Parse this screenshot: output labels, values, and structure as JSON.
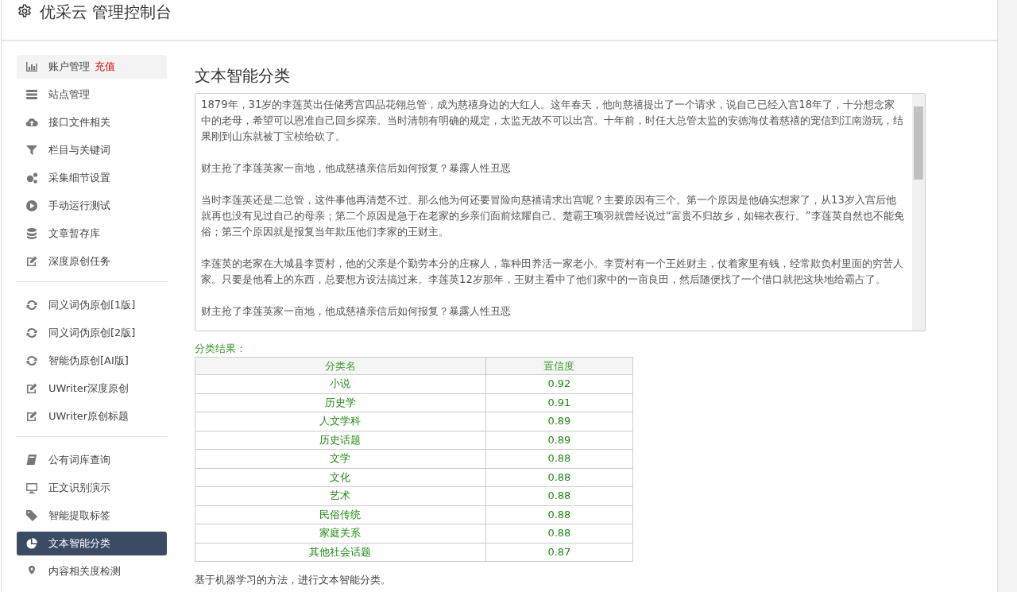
{
  "header": {
    "title": "优采云 管理控制台"
  },
  "sidebar": {
    "groups": [
      [
        {
          "label": "账户管理",
          "badge": "充值",
          "selected": false,
          "highlighted": true
        },
        {
          "label": "站点管理",
          "selected": false,
          "highlighted": false
        },
        {
          "label": "接口文件相关",
          "selected": false,
          "highlighted": false
        },
        {
          "label": "栏目与关键词",
          "selected": false,
          "highlighted": false
        },
        {
          "label": "采集细节设置",
          "selected": false,
          "highlighted": false
        },
        {
          "label": "手动运行测试",
          "selected": false,
          "highlighted": false
        },
        {
          "label": "文章暂存库",
          "selected": false,
          "highlighted": false
        },
        {
          "label": "深度原创任务",
          "selected": false,
          "highlighted": false
        }
      ],
      [
        {
          "label": "同义词伪原创[1版]",
          "selected": false,
          "highlighted": false
        },
        {
          "label": "同义词伪原创[2版]",
          "selected": false,
          "highlighted": false
        },
        {
          "label": "智能伪原创[AI版]",
          "selected": false,
          "highlighted": false
        },
        {
          "label": "UWriter深度原创",
          "selected": false,
          "highlighted": false
        },
        {
          "label": "UWriter原创标题",
          "selected": false,
          "highlighted": false
        }
      ],
      [
        {
          "label": "公有词库查询",
          "selected": false,
          "highlighted": false
        },
        {
          "label": "正文识别演示",
          "selected": false,
          "highlighted": false
        },
        {
          "label": "智能提取标签",
          "selected": false,
          "highlighted": false
        },
        {
          "label": "文本智能分类",
          "selected": true,
          "highlighted": false
        },
        {
          "label": "内容相关度检测",
          "selected": false,
          "highlighted": false
        }
      ]
    ]
  },
  "main": {
    "title": "文本智能分类",
    "text_input": {
      "paragraphs": [
        "1879年，31岁的李莲英出任储秀宫四品花翎总管，成为慈禧身边的大红人。这年春天，他向慈禧提出了一个请求，说自己已经入宫18年了，十分想念家中的老母，希望可以恩准自己回乡探亲。当时清朝有明确的规定，太监无故不可以出宫。十年前，时任大总管太监的安德海仗着慈禧的宠信到江南游玩，结果刚到山东就被丁宝桢给砍了。",
        "财主抢了李莲英家一亩地，他成慈禧亲信后如何报复？暴露人性丑恶",
        "当时李莲英还是二总管，这件事他再清楚不过。那么他为何还要冒险向慈禧请求出宫呢？主要原因有三个。第一个原因是他确实想家了，从13岁入宫后他就再也没有见过自己的母亲；第二个原因是急于在老家的乡亲们面前炫耀自己。楚霸王项羽就曾经说过“富贵不归故乡，如锦衣夜行。”李莲英自然也不能免俗；第三个原因就是报复当年欺压他们李家的王财主。",
        "李莲英的老家在大城县李贾村，他的父亲是个勤劳本分的庄稼人，靠种田养活一家老小。李贾村有一个王姓财主，仗着家里有钱，经常欺负村里面的穷苦人家。只要是他看上的东西，总要想方设法搞过来。李莲英12岁那年，王财主看中了他们家中的一亩良田，然后随便找了一个借口就把这块地给霸占了。",
        "财主抢了李莲英家一亩地，他成慈禧亲信后如何报复？暴露人性丑恶"
      ]
    },
    "result_label": "分类结果：",
    "table": {
      "columns": [
        "分类名",
        "置信度"
      ],
      "rows": [
        [
          "小说",
          "0.92"
        ],
        [
          "历史学",
          "0.91"
        ],
        [
          "人文学科",
          "0.89"
        ],
        [
          "历史话题",
          "0.89"
        ],
        [
          "文学",
          "0.88"
        ],
        [
          "文化",
          "0.88"
        ],
        [
          "艺术",
          "0.88"
        ],
        [
          "民俗传统",
          "0.88"
        ],
        [
          "家庭关系",
          "0.88"
        ],
        [
          "其他社会话题",
          "0.87"
        ]
      ]
    },
    "description": "基于机器学习的方法，进行文本智能分类。"
  }
}
